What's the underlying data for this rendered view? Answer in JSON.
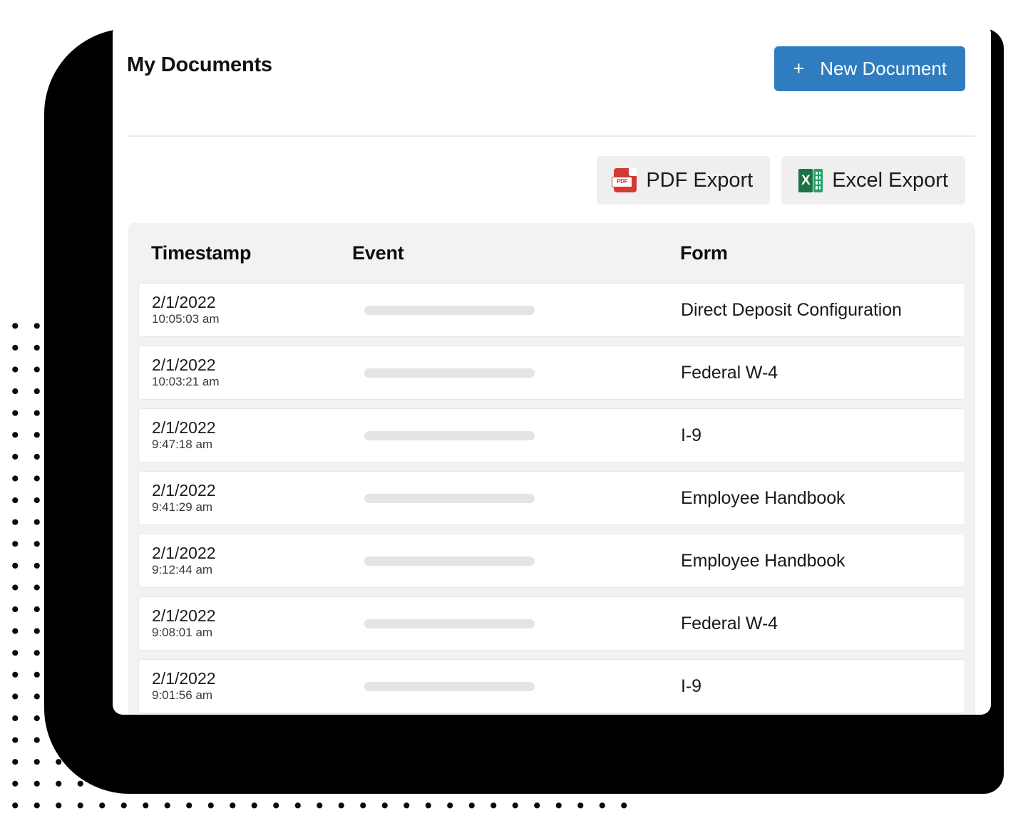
{
  "header": {
    "title": "My Documents",
    "new_document_button": {
      "plus": "+",
      "label": "New Document"
    }
  },
  "export_bar": {
    "pdf": {
      "label": "PDF Export",
      "icon": "pdf-file-icon",
      "icon_text": "PDF",
      "color": "#d43a35"
    },
    "excel": {
      "label": "Excel Export",
      "icon": "excel-file-icon",
      "icon_text": "X",
      "color": "#21a366"
    }
  },
  "table": {
    "columns": [
      "Timestamp",
      "Event",
      "Form"
    ],
    "rows": [
      {
        "date": "2/1/2022",
        "time": "10:05:03 am",
        "event": "",
        "form": "Direct Deposit Configuration"
      },
      {
        "date": "2/1/2022",
        "time": "10:03:21 am",
        "event": "",
        "form": "Federal W-4"
      },
      {
        "date": "2/1/2022",
        "time": "9:47:18 am",
        "event": "",
        "form": "I-9"
      },
      {
        "date": "2/1/2022",
        "time": "9:41:29 am",
        "event": "",
        "form": "Employee Handbook"
      },
      {
        "date": "2/1/2022",
        "time": "9:12:44 am",
        "event": "",
        "form": "Employee Handbook"
      },
      {
        "date": "2/1/2022",
        "time": "9:08:01 am",
        "event": "",
        "form": "Federal W-4"
      },
      {
        "date": "2/1/2022",
        "time": "9:01:56 am",
        "event": "",
        "form": "I-9"
      }
    ]
  },
  "theme": {
    "accent": "#2f7cc0",
    "card_background": "#ffffff",
    "table_background": "#f2f2f3",
    "redaction_color": "#e4e4e5",
    "shadow_color": "#000000"
  }
}
